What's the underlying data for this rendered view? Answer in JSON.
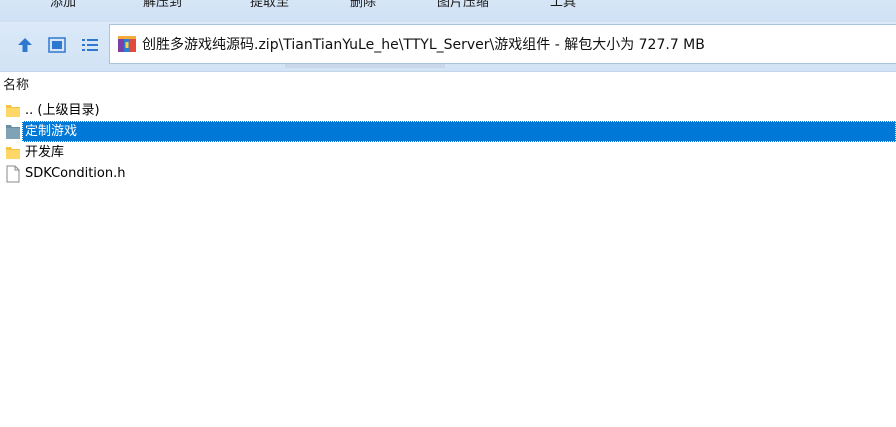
{
  "toolbar": {
    "buttons": [
      "添加",
      "解压到",
      "提取至",
      "删除",
      "图片压缩",
      "工具"
    ]
  },
  "address": {
    "path": "创胜多游戏纯源码.zip\\TianTianYuLe_he\\TTYL_Server\\游戏组件 - 解包大小为 727.7 MB"
  },
  "list": {
    "column_name": "名称",
    "items": [
      {
        "name": ".. (上级目录)",
        "icon": "folder-icon"
      },
      {
        "name": "定制游戏",
        "icon": "folder-icon",
        "selected": true
      },
      {
        "name": "开发库",
        "icon": "folder-icon"
      },
      {
        "name": "SDKCondition.h",
        "icon": "file-icon"
      }
    ]
  },
  "colors": {
    "selection": "#0078d7",
    "folder": "#f5c242",
    "nav_icon": "#2f78d0"
  }
}
